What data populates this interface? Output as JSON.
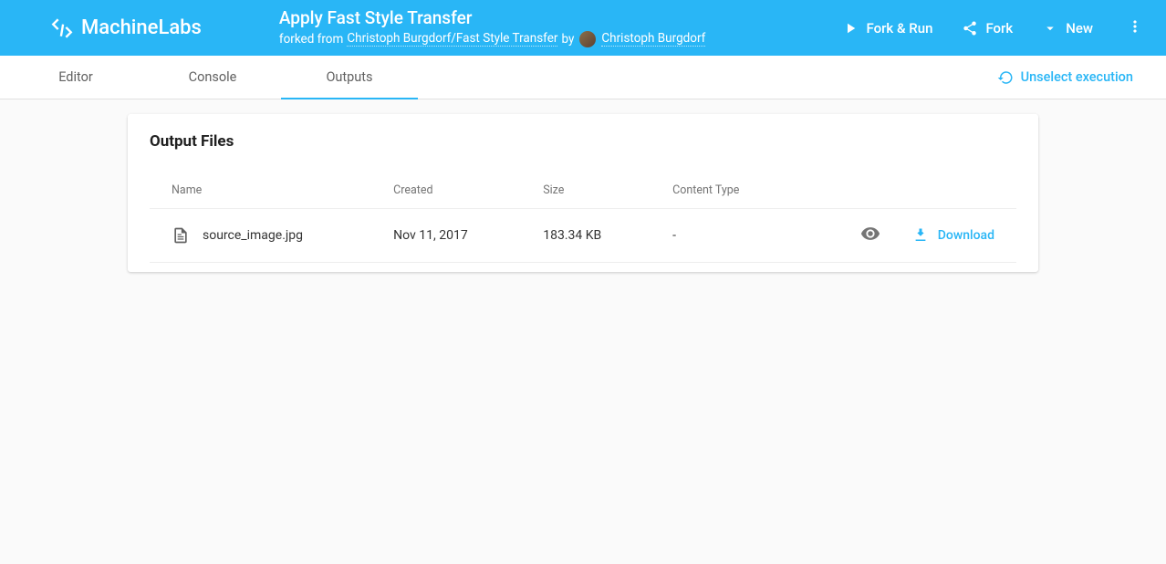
{
  "brand": {
    "name": "MachineLabs"
  },
  "project": {
    "title": "Apply Fast Style Transfer",
    "forked_prefix": "forked from",
    "forked_link": "Christoph Burgdorf/Fast Style Transfer",
    "by": "by",
    "author": "Christoph Burgdorf"
  },
  "header_actions": {
    "fork_run": "Fork & Run",
    "fork": "Fork",
    "new": "New"
  },
  "tabs": {
    "editor": "Editor",
    "console": "Console",
    "outputs": "Outputs",
    "unselect": "Unselect execution"
  },
  "card": {
    "title": "Output Files",
    "columns": {
      "name": "Name",
      "created": "Created",
      "size": "Size",
      "content_type": "Content Type"
    },
    "rows": [
      {
        "name": "source_image.jpg",
        "created": "Nov 11, 2017",
        "size": "183.34 KB",
        "content_type": "-",
        "download": "Download"
      }
    ]
  }
}
